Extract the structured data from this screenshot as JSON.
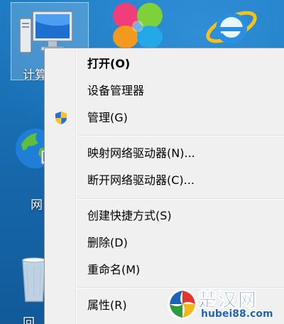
{
  "desktop": {
    "icons": [
      {
        "name": "computer",
        "label": "计算机",
        "visible_label": "计算",
        "selected": true
      },
      {
        "name": "clover-app",
        "label": "",
        "visible_label": ""
      },
      {
        "name": "internet-explorer",
        "label": "",
        "visible_label": ""
      },
      {
        "name": "network",
        "label": "网络",
        "visible_label": "网"
      },
      {
        "name": "recycle-bin",
        "label": "回收站",
        "visible_label": "回"
      }
    ]
  },
  "context_menu": {
    "items": [
      {
        "label": "打开(O)",
        "bold": true,
        "icon": null
      },
      {
        "label": "设备管理器",
        "bold": false,
        "icon": null
      },
      {
        "label": "管理(G)",
        "bold": false,
        "icon": "uac-shield-icon"
      },
      {
        "separator": true
      },
      {
        "label": "映射网络驱动器(N)...",
        "bold": false,
        "icon": null
      },
      {
        "label": "断开网络驱动器(C)...",
        "bold": false,
        "icon": null
      },
      {
        "separator": true
      },
      {
        "label": "创建快捷方式(S)",
        "bold": false,
        "icon": null
      },
      {
        "label": "删除(D)",
        "bold": false,
        "icon": null
      },
      {
        "label": "重命名(M)",
        "bold": false,
        "icon": null
      },
      {
        "separator": true
      },
      {
        "label": "属性(R)",
        "bold": false,
        "icon": null
      }
    ]
  },
  "watermark": {
    "title": "楚汉网",
    "url": "hubei88.com"
  },
  "colors": {
    "desktop_bg": "#1a6fb4",
    "menu_bg": "#f0f0f0",
    "watermark": "#1d63b8"
  }
}
